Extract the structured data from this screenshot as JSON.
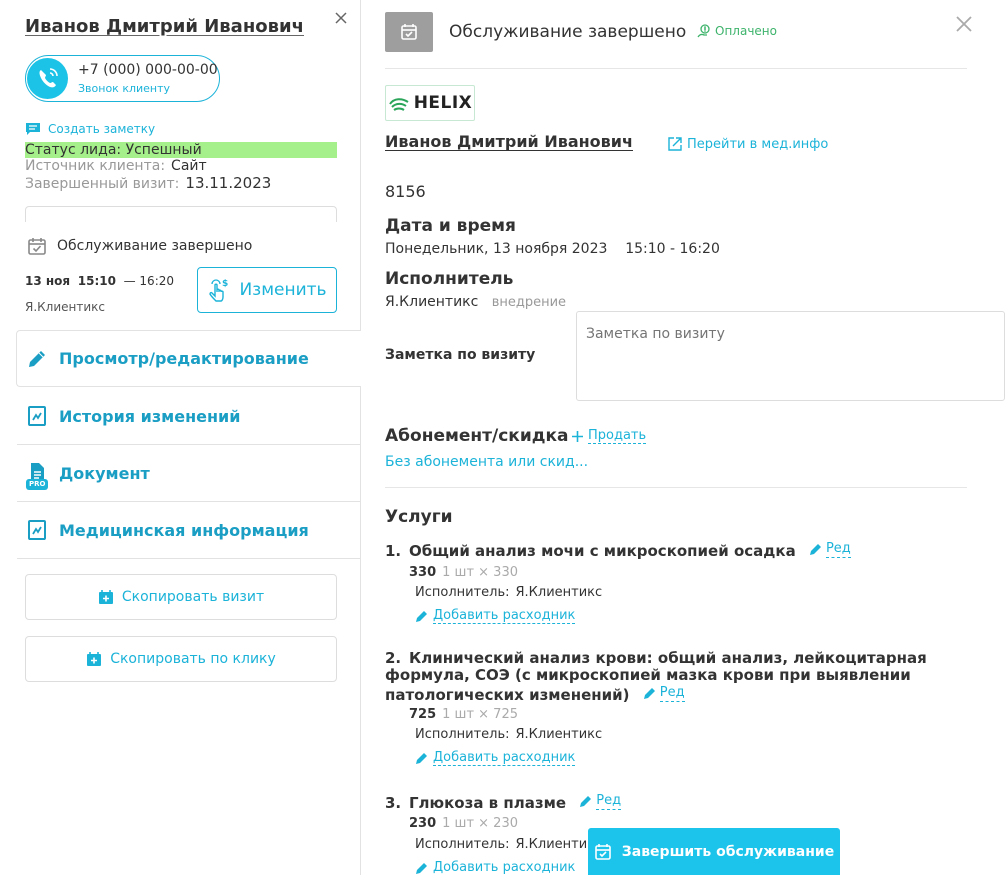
{
  "client": {
    "name": "Иванов Дмитрий Иванович",
    "phone": "+7 (000) 000-00-00",
    "call_label": "Звонок клиенту",
    "create_note": "Создать заметку",
    "lead_status_label": "Статус лида:",
    "lead_status_value": "Успешный",
    "source_label": "Источник клиента:",
    "source_value": "Сайт",
    "last_visit_label": "Завершенный визит:",
    "last_visit_value": "13.11.2023"
  },
  "visit_summary": {
    "status": "Обслуживание завершено",
    "date": "13 ноя",
    "start": "15:10",
    "end": "— 16:20",
    "executor": "Я.Клиентикс",
    "change_button": "Изменить"
  },
  "menu": [
    {
      "label": "Просмотр/редактирование",
      "icon": "pencil-icon",
      "active": true
    },
    {
      "label": "История изменений",
      "icon": "history-icon",
      "active": false
    },
    {
      "label": "Документ",
      "icon": "document-icon",
      "badge": "PRO",
      "active": false
    },
    {
      "label": "Медицинская информация",
      "icon": "medical-info-icon",
      "active": false
    }
  ],
  "copy_buttons": {
    "copy_visit": "Скопировать визит",
    "copy_by_click": "Скопировать по клику"
  },
  "header": {
    "title": "Обслуживание завершено",
    "payment_status": "Оплачено"
  },
  "detail": {
    "lab_logo": "HELIX",
    "patient_name": "Иванов Дмитрий Иванович",
    "med_link": "Перейти в мед.инфо",
    "visit_number": "8156",
    "datetime_title": "Дата и время",
    "datetime_value": "Понедельник, 13 ноября 2023",
    "time_range": "15:10 - 16:20",
    "executor_title": "Исполнитель",
    "executor_name": "Я.Клиентикс",
    "executor_role": "внедрение",
    "note_label": "Заметка по визиту",
    "note_placeholder": "Заметка по визиту",
    "subscription_title": "Абонемент/скидка",
    "sell_link": "Продать",
    "no_subscription": "Без абонемента или скид..."
  },
  "services": {
    "title": "Услуги",
    "edit_label": "Ред",
    "executor_label": "Исполнитель:",
    "add_consumable": "Добавить расходник",
    "items": [
      {
        "num": "1.",
        "name": "Общий анализ мочи с микроскопией осадка",
        "price": "330",
        "qty": "1 шт × 330",
        "executor": "Я.Клиентикс"
      },
      {
        "num": "2.",
        "name": "Клинический анализ крови: общий анализ, лейкоцитарная формула, СОЭ (с микроскопией мазка крови при выявлении патологических изменений)",
        "price": "725",
        "qty": "1 шт × 725",
        "executor": "Я.Клиентикс"
      },
      {
        "num": "3.",
        "name": "Глюкоза в плазме",
        "price": "230",
        "qty": "1 шт × 230",
        "executor": "Я.Клиентикс"
      }
    ]
  },
  "footer": {
    "finish_button": "Завершить обслуживание"
  }
}
